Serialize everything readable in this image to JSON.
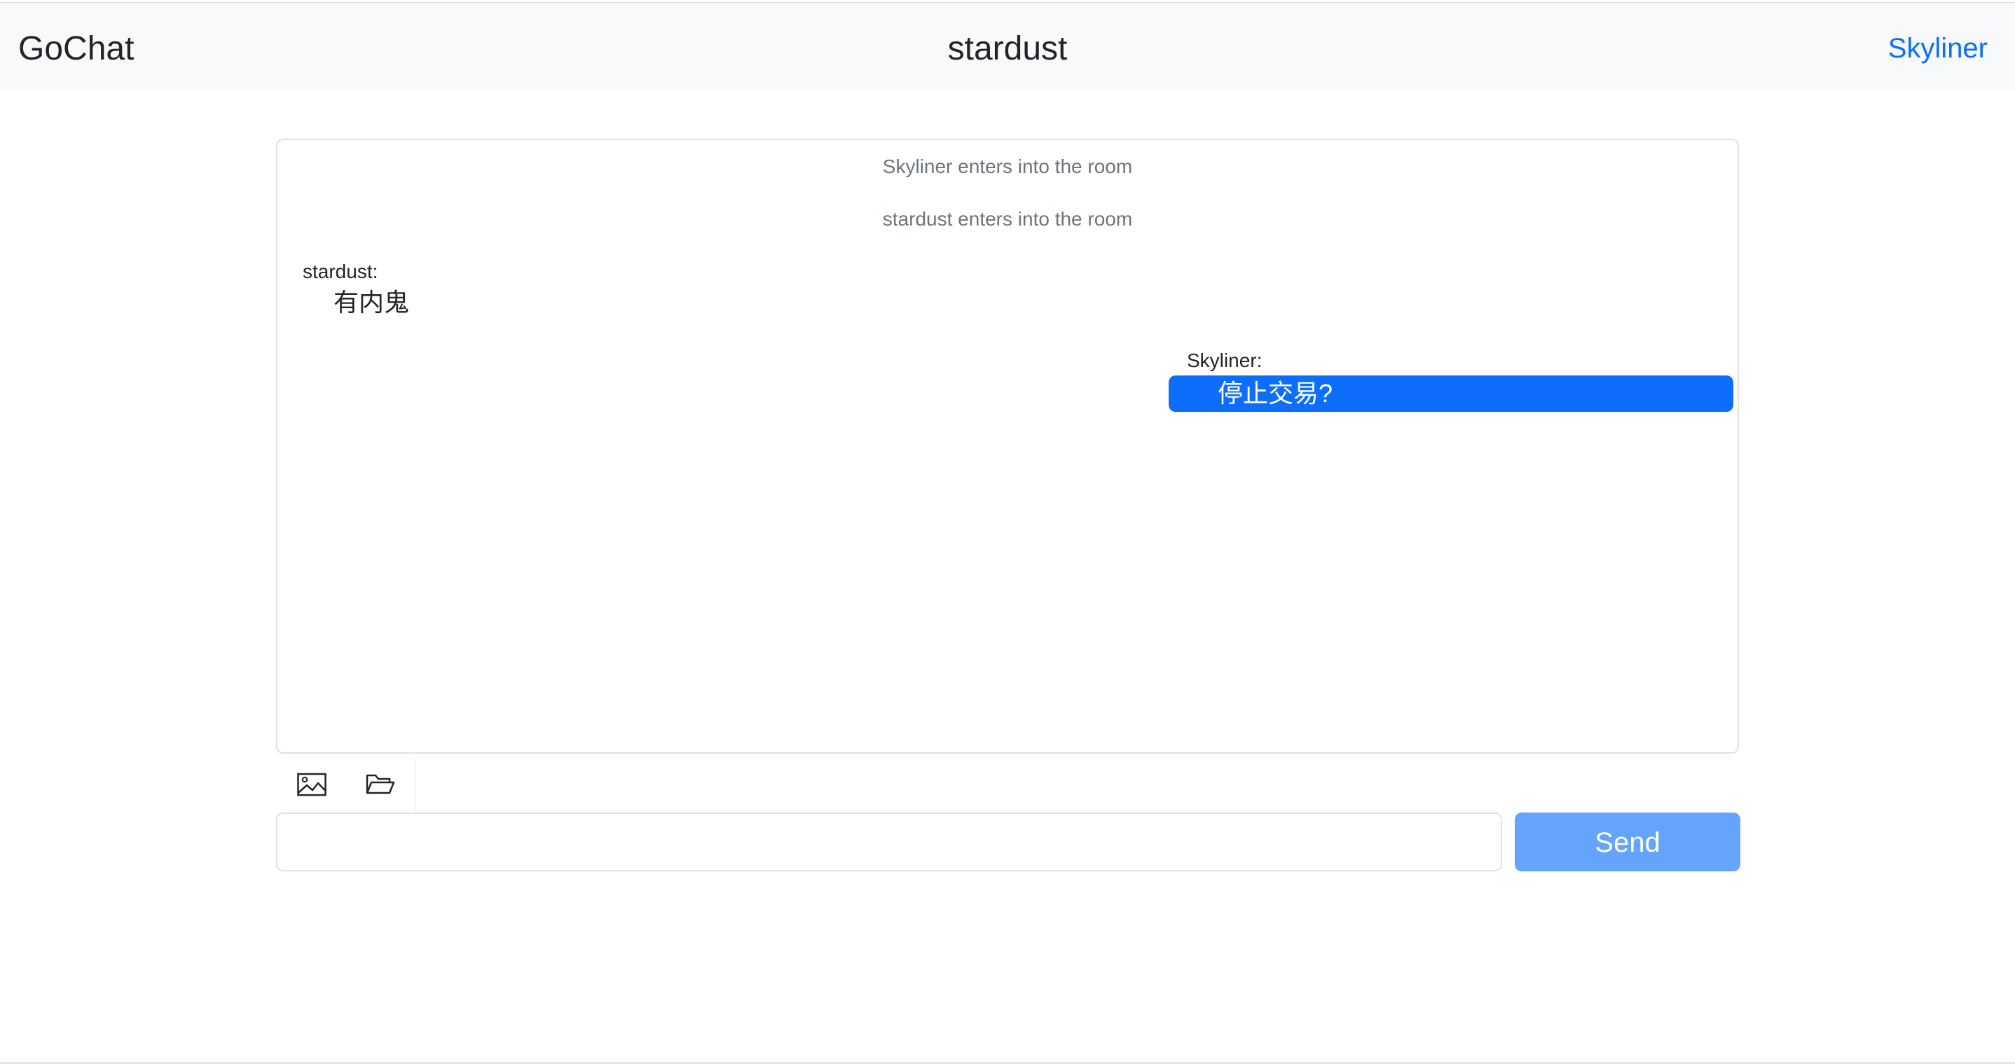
{
  "header": {
    "brand": "GoChat",
    "room_title": "stardust",
    "current_user": "Skyliner"
  },
  "chat": {
    "system_messages": [
      "Skyliner enters into the room",
      "stardust enters into the room"
    ],
    "incoming": {
      "sender": "stardust:",
      "text": "有内鬼"
    },
    "outgoing": {
      "sender": "Skyliner:",
      "text": "停止交易?"
    }
  },
  "composer": {
    "toolbar_icons": [
      "image-icon",
      "folder-icon"
    ],
    "input_value": "",
    "input_placeholder": "",
    "send_label": "Send"
  },
  "colors": {
    "accent": "#0d6efd",
    "send_button": "#64a4fc",
    "header_bg": "#f8f9fa"
  }
}
